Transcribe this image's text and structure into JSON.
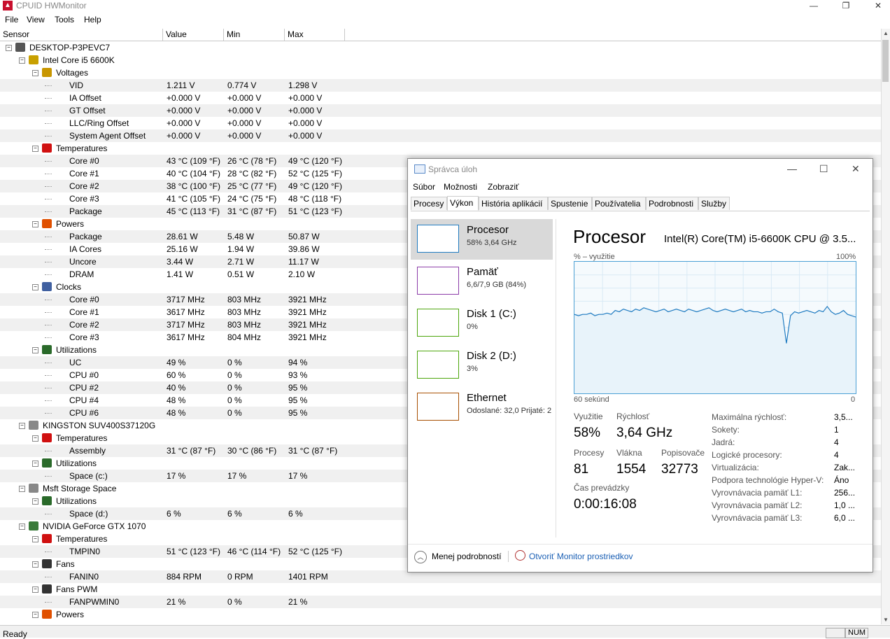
{
  "window": {
    "title": "CPUID HWMonitor"
  },
  "menu": [
    "File",
    "View",
    "Tools",
    "Help"
  ],
  "columns": {
    "sensor": "Sensor",
    "value": "Value",
    "min": "Min",
    "max": "Max"
  },
  "rows": [
    {
      "level": 0,
      "icon": "computer-icon",
      "label": "DESKTOP-P3PEVC7",
      "value": "",
      "min": "",
      "max": ""
    },
    {
      "level": 1,
      "icon": "cpu-chip-icon",
      "label": "Intel Core i5 6600K",
      "value": "",
      "min": "",
      "max": ""
    },
    {
      "level": 2,
      "icon": "voltage-icon",
      "label": "Voltages",
      "value": "",
      "min": "",
      "max": ""
    },
    {
      "level": 3,
      "icon": "",
      "label": "VID",
      "value": "1.211 V",
      "min": "0.774 V",
      "max": "1.298 V"
    },
    {
      "level": 3,
      "icon": "",
      "label": "IA Offset",
      "value": "+0.000 V",
      "min": "+0.000 V",
      "max": "+0.000 V"
    },
    {
      "level": 3,
      "icon": "",
      "label": "GT Offset",
      "value": "+0.000 V",
      "min": "+0.000 V",
      "max": "+0.000 V"
    },
    {
      "level": 3,
      "icon": "",
      "label": "LLC/Ring Offset",
      "value": "+0.000 V",
      "min": "+0.000 V",
      "max": "+0.000 V"
    },
    {
      "level": 3,
      "icon": "",
      "label": "System Agent Offset",
      "value": "+0.000 V",
      "min": "+0.000 V",
      "max": "+0.000 V"
    },
    {
      "level": 2,
      "icon": "thermometer-icon",
      "label": "Temperatures",
      "value": "",
      "min": "",
      "max": ""
    },
    {
      "level": 3,
      "icon": "",
      "label": "Core #0",
      "value": "43 °C  (109 °F)",
      "min": "26 °C  (78 °F)",
      "max": "49 °C  (120 °F)"
    },
    {
      "level": 3,
      "icon": "",
      "label": "Core #1",
      "value": "40 °C  (104 °F)",
      "min": "28 °C  (82 °F)",
      "max": "52 °C  (125 °F)"
    },
    {
      "level": 3,
      "icon": "",
      "label": "Core #2",
      "value": "38 °C  (100 °F)",
      "min": "25 °C  (77 °F)",
      "max": "49 °C  (120 °F)"
    },
    {
      "level": 3,
      "icon": "",
      "label": "Core #3",
      "value": "41 °C  (105 °F)",
      "min": "24 °C  (75 °F)",
      "max": "48 °C  (118 °F)"
    },
    {
      "level": 3,
      "icon": "",
      "label": "Package",
      "value": "45 °C  (113 °F)",
      "min": "31 °C  (87 °F)",
      "max": "51 °C  (123 °F)"
    },
    {
      "level": 2,
      "icon": "power-icon",
      "label": "Powers",
      "value": "",
      "min": "",
      "max": ""
    },
    {
      "level": 3,
      "icon": "",
      "label": "Package",
      "value": "28.61 W",
      "min": "5.48 W",
      "max": "50.87 W"
    },
    {
      "level": 3,
      "icon": "",
      "label": "IA Cores",
      "value": "25.16 W",
      "min": "1.94 W",
      "max": "39.86 W"
    },
    {
      "level": 3,
      "icon": "",
      "label": "Uncore",
      "value": "3.44 W",
      "min": "2.71 W",
      "max": "11.17 W"
    },
    {
      "level": 3,
      "icon": "",
      "label": "DRAM",
      "value": "1.41 W",
      "min": "0.51 W",
      "max": "2.10 W"
    },
    {
      "level": 2,
      "icon": "clock-icon",
      "label": "Clocks",
      "value": "",
      "min": "",
      "max": ""
    },
    {
      "level": 3,
      "icon": "",
      "label": "Core #0",
      "value": "3717 MHz",
      "min": "803 MHz",
      "max": "3921 MHz"
    },
    {
      "level": 3,
      "icon": "",
      "label": "Core #1",
      "value": "3617 MHz",
      "min": "803 MHz",
      "max": "3921 MHz"
    },
    {
      "level": 3,
      "icon": "",
      "label": "Core #2",
      "value": "3717 MHz",
      "min": "803 MHz",
      "max": "3921 MHz"
    },
    {
      "level": 3,
      "icon": "",
      "label": "Core #3",
      "value": "3617 MHz",
      "min": "804 MHz",
      "max": "3921 MHz"
    },
    {
      "level": 2,
      "icon": "utilization-icon",
      "label": "Utilizations",
      "value": "",
      "min": "",
      "max": ""
    },
    {
      "level": 3,
      "icon": "",
      "label": "UC",
      "value": "49 %",
      "min": "0 %",
      "max": "94 %"
    },
    {
      "level": 3,
      "icon": "",
      "label": "CPU #0",
      "value": "60 %",
      "min": "0 %",
      "max": "93 %"
    },
    {
      "level": 3,
      "icon": "",
      "label": "CPU #2",
      "value": "40 %",
      "min": "0 %",
      "max": "95 %"
    },
    {
      "level": 3,
      "icon": "",
      "label": "CPU #4",
      "value": "48 %",
      "min": "0 %",
      "max": "95 %"
    },
    {
      "level": 3,
      "icon": "",
      "label": "CPU #6",
      "value": "48 %",
      "min": "0 %",
      "max": "95 %"
    },
    {
      "level": 1,
      "icon": "drive-icon",
      "label": "KINGSTON SUV400S37120G",
      "value": "",
      "min": "",
      "max": ""
    },
    {
      "level": 2,
      "icon": "thermometer-icon",
      "label": "Temperatures",
      "value": "",
      "min": "",
      "max": ""
    },
    {
      "level": 3,
      "icon": "",
      "label": "Assembly",
      "value": "31 °C  (87 °F)",
      "min": "30 °C  (86 °F)",
      "max": "31 °C  (87 °F)"
    },
    {
      "level": 2,
      "icon": "utilization-icon",
      "label": "Utilizations",
      "value": "",
      "min": "",
      "max": ""
    },
    {
      "level": 3,
      "icon": "",
      "label": "Space (c:)",
      "value": "17 %",
      "min": "17 %",
      "max": "17 %"
    },
    {
      "level": 1,
      "icon": "drive-icon",
      "label": "Msft Storage Space",
      "value": "",
      "min": "",
      "max": ""
    },
    {
      "level": 2,
      "icon": "utilization-icon",
      "label": "Utilizations",
      "value": "",
      "min": "",
      "max": ""
    },
    {
      "level": 3,
      "icon": "",
      "label": "Space (d:)",
      "value": "6 %",
      "min": "6 %",
      "max": "6 %"
    },
    {
      "level": 1,
      "icon": "gpu-icon",
      "label": "NVIDIA GeForce GTX 1070",
      "value": "",
      "min": "",
      "max": ""
    },
    {
      "level": 2,
      "icon": "thermometer-icon",
      "label": "Temperatures",
      "value": "",
      "min": "",
      "max": ""
    },
    {
      "level": 3,
      "icon": "",
      "label": "TMPIN0",
      "value": "51 °C  (123 °F)",
      "min": "46 °C  (114 °F)",
      "max": "52 °C  (125 °F)"
    },
    {
      "level": 2,
      "icon": "fan-icon",
      "label": "Fans",
      "value": "",
      "min": "",
      "max": ""
    },
    {
      "level": 3,
      "icon": "",
      "label": "FANIN0",
      "value": "884 RPM",
      "min": "0 RPM",
      "max": "1401 RPM"
    },
    {
      "level": 2,
      "icon": "fan-icon",
      "label": "Fans PWM",
      "value": "",
      "min": "",
      "max": ""
    },
    {
      "level": 3,
      "icon": "",
      "label": "FANPWMIN0",
      "value": "21 %",
      "min": "0 %",
      "max": "21 %"
    },
    {
      "level": 2,
      "icon": "power-icon",
      "label": "Powers",
      "value": "",
      "min": "",
      "max": ""
    }
  ],
  "status": {
    "text": "Ready",
    "num": "NUM"
  },
  "taskmanager": {
    "title": "Správca úloh",
    "menu": [
      "Súbor",
      "Možnosti",
      "Zobraziť"
    ],
    "tabs": [
      "Procesy",
      "Výkon",
      "História aplikácií",
      "Spustenie",
      "Používatelia",
      "Podrobnosti",
      "Služby"
    ],
    "active_tab": 1,
    "side": [
      {
        "name": "Procesor",
        "sub": "58%  3,64 GHz",
        "color": "#1f7bc1"
      },
      {
        "name": "Pamäť",
        "sub": "6,6/7,9 GB (84%)",
        "color": "#8b3ca8"
      },
      {
        "name": "Disk 1 (C:)",
        "sub": "0%",
        "color": "#4da60c"
      },
      {
        "name": "Disk 2 (D:)",
        "sub": "3%",
        "color": "#4da60c"
      },
      {
        "name": "Ethernet",
        "sub": "Odoslané: 32,0  Prijaté: 2",
        "color": "#a74f01"
      }
    ],
    "heading": "Procesor",
    "cpu_name": "Intel(R) Core(TM) i5-6600K CPU @ 3.5...",
    "graph_label": "% – využitie",
    "graph_max": "100%",
    "graph_time": "60 sekúnd",
    "graph_min": "0",
    "utilization_series": [
      60,
      59,
      60,
      60,
      61,
      59,
      60,
      60,
      61,
      60,
      63,
      62,
      64,
      63,
      62,
      64,
      63,
      65,
      64,
      63,
      62,
      63,
      64,
      62,
      63,
      64,
      63,
      62,
      64,
      63,
      62,
      63,
      64,
      65,
      63,
      62,
      63,
      64,
      63,
      62,
      63,
      64,
      62,
      63,
      62,
      62,
      61,
      62,
      62,
      64,
      62,
      61,
      38,
      59,
      62,
      61,
      62,
      63,
      62,
      61,
      63,
      62,
      66,
      62,
      60,
      61,
      63,
      60,
      59,
      58
    ],
    "stats": {
      "utilization_label": "Využitie",
      "utilization": "58%",
      "speed_label": "Rýchlosť",
      "speed": "3,64 GHz",
      "processes_label": "Procesy",
      "processes": "81",
      "threads_label": "Vlákna",
      "threads": "1554",
      "handles_label": "Popisovače",
      "handles": "32773",
      "uptime_label": "Čas prevádzky",
      "uptime": "0:00:16:08"
    },
    "details": [
      {
        "k": "Maximálna rýchlosť:",
        "v": "3,5..."
      },
      {
        "k": "Sokety:",
        "v": "1"
      },
      {
        "k": "Jadrá:",
        "v": "4"
      },
      {
        "k": "Logické procesory:",
        "v": "4"
      },
      {
        "k": "Virtualizácia:",
        "v": "Zak..."
      },
      {
        "k": "Podpora technológie Hyper-V:",
        "v": "Áno"
      },
      {
        "k": "Vyrovnávacia pamäť L1:",
        "v": "256..."
      },
      {
        "k": "Vyrovnávacia pamäť L2:",
        "v": "1,0 ..."
      },
      {
        "k": "Vyrovnávacia pamäť L3:",
        "v": "6,0 ..."
      }
    ],
    "less_details": "Menej podrobností",
    "resource_monitor": "Otvoriť Monitor prostriedkov"
  },
  "colors": {
    "graph_line": "#1f7bc1",
    "graph_fill": "#e8f3fa",
    "link": "#1a5fb4"
  }
}
